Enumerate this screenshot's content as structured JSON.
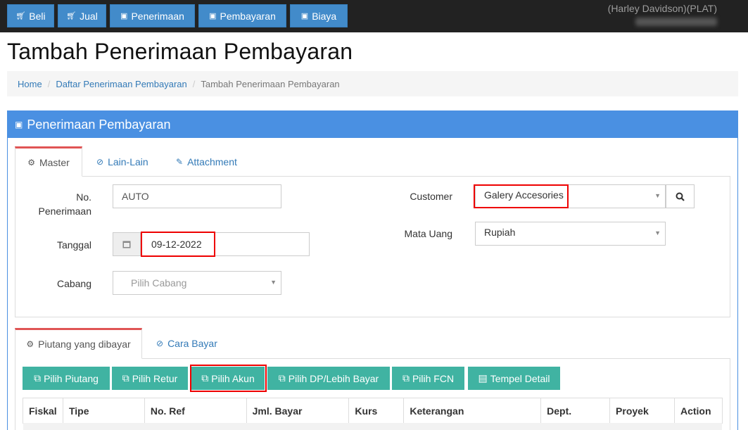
{
  "topnav": {
    "buttons": [
      {
        "label": "Beli",
        "icon": "cart-icon"
      },
      {
        "label": "Jual",
        "icon": "cart-icon"
      },
      {
        "label": "Penerimaan",
        "icon": "money-icon"
      },
      {
        "label": "Pembayaran",
        "icon": "money-icon"
      },
      {
        "label": "Biaya",
        "icon": "money-icon"
      }
    ],
    "company": "(Harley Davidson)(PLAT)"
  },
  "page_title": "Tambah Penerimaan Pembayaran",
  "breadcrumb": {
    "home": "Home",
    "list": "Daftar Penerimaan Pembayaran",
    "current": "Tambah Penerimaan Pembayaran"
  },
  "panel": {
    "title": "Penerimaan Pembayaran",
    "tabs": [
      {
        "label": "Master",
        "icon": "cogs-icon"
      },
      {
        "label": "Lain-Lain",
        "icon": "check-circle-icon"
      },
      {
        "label": "Attachment",
        "icon": "paperclip-icon"
      }
    ],
    "form": {
      "no_penerimaan_label": "No. Penerimaan",
      "no_penerimaan_value": "AUTO",
      "tanggal_label": "Tanggal",
      "tanggal_value": "09-12-2022",
      "cabang_label": "Cabang",
      "cabang_placeholder": "Pilih Cabang",
      "customer_label": "Customer",
      "customer_value": "Galery Accesories",
      "mata_uang_label": "Mata Uang",
      "mata_uang_value": "Rupiah"
    }
  },
  "detail": {
    "tabs": [
      {
        "label": "Piutang yang dibayar",
        "icon": "cogs-icon"
      },
      {
        "label": "Cara Bayar",
        "icon": "check-circle-icon"
      }
    ],
    "buttons": [
      {
        "label": "Pilih Piutang",
        "icon": "copy-icon"
      },
      {
        "label": "Pilih Retur",
        "icon": "copy-icon"
      },
      {
        "label": "Pilih Akun",
        "icon": "copy-icon"
      },
      {
        "label": "Pilih DP/Lebih Bayar",
        "icon": "copy-icon"
      },
      {
        "label": "Pilih FCN",
        "icon": "copy-icon"
      },
      {
        "label": "Tempel Detail",
        "icon": "paste-icon"
      }
    ],
    "columns": [
      "Fiskal",
      "Tipe",
      "No. Ref",
      "Jml. Bayar",
      "Kurs",
      "Keterangan",
      "Dept.",
      "Proyek",
      "Action"
    ]
  },
  "colors": {
    "topbar": "#222222",
    "primary": "#428bca",
    "panel_header": "#4a90e2",
    "teal_button": "#40b3a2",
    "highlight": "#ee0000"
  }
}
